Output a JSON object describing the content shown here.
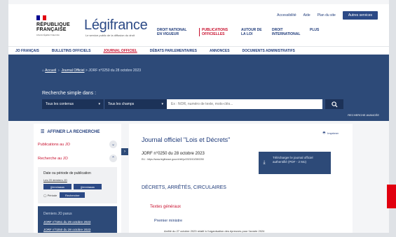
{
  "colors": {
    "brand": "#2c4a86",
    "band": "#2d4a78",
    "accent": "#c8102e",
    "feedback_tab": "#e1000f"
  },
  "header": {
    "toplinks": [
      "Accessibilité",
      "Aide",
      "Plan du site"
    ],
    "top_button": "Autres services",
    "rf_line1": "RÉPUBLIQUE",
    "rf_line2": "FRANÇAISE",
    "rf_motto": "Liberté Égalité Fraternité",
    "logo": "Légifrance",
    "logo_sub": "Le service public de la diffusion du droit",
    "topnav": [
      {
        "label": "DROIT NATIONAL EN VIGUEUR",
        "active": false
      },
      {
        "label": "PUBLICATIONS OFFICIELLES",
        "active": true
      },
      {
        "label": "AUTOUR DE LA LOI",
        "active": false
      },
      {
        "label": "DROIT INTERNATIONAL",
        "active": false
      },
      {
        "label": "PLUS",
        "active": false
      }
    ]
  },
  "mainnav": [
    {
      "label": "JO FRANÇAIS",
      "active": false
    },
    {
      "label": "BULLETINS OFFICIELS",
      "active": false
    },
    {
      "label": "JOURNAL OFFICIEL",
      "active": true
    },
    {
      "label": "DÉBATS PARLEMENTAIRES",
      "active": false
    },
    {
      "label": "ANNONCES",
      "active": false
    },
    {
      "label": "DOCUMENTS ADMINISTRATIFS",
      "active": false
    }
  ],
  "breadcrumb": {
    "home": "Accueil",
    "link": "Journal Officiel",
    "current": "> JORF n°0250 du 28 octobre 2023"
  },
  "search": {
    "title": "Recherche simple dans :",
    "select1": "Tous les contenus",
    "select2": "Tous les champs",
    "placeholder": "Ex : NOR, numéro de texte, mots-clés...",
    "advanced": "RECHERCHE AVANCÉE"
  },
  "sidebar": {
    "heading": "AFFINER LA RECHERCHE",
    "row1": "Publications au JO",
    "row2": "Recherche au JO",
    "period_title": "Date ou période de publication",
    "period_link": "Les 20 derniers JO",
    "date1": "jj/mm/aaaa",
    "date2": "jj/mm/aaaa",
    "radio": "Période",
    "btn": "Rechercher",
    "lower_head": "Derniers JO parus",
    "lower_links": [
      "JORF n°0251 du 29 octobre 2023",
      "JORF n°0250 du 28 octobre 2023"
    ]
  },
  "content": {
    "print": "Imprimer",
    "title": "Journal officiel \"Lois et Décrets\"",
    "num": "JORF n°0250 du 28 octobre 2023",
    "eli": "ELI : https://www.legifrance.gouv.fr/eli/jo/2023/10/28/0250",
    "dl": "Télécharger le journal officiel authentifié (PDF - 2 Mo)",
    "section": "DÉCRETS, ARRÊTÉS, CIRCULAIRES",
    "category": "Textes généraux",
    "ministry": "Premier ministre",
    "entry": "Arrêté du 27 octobre 2023 relatif à l'organisation des épreuves pour l'année 2024"
  }
}
